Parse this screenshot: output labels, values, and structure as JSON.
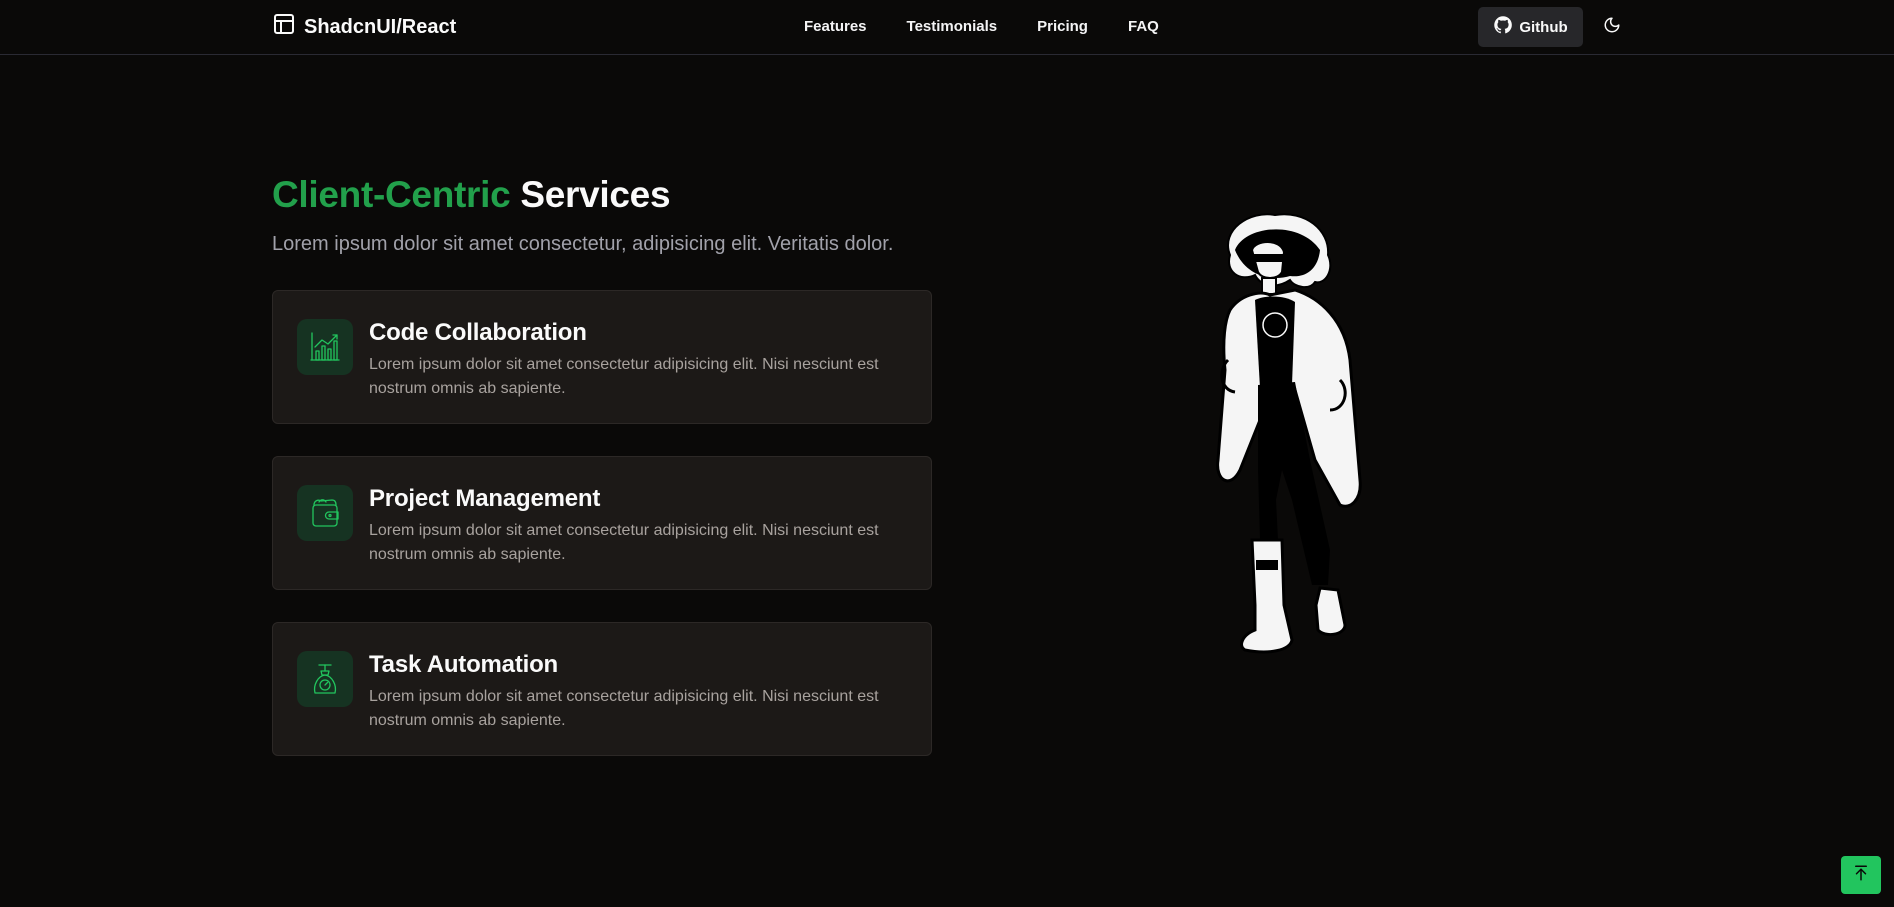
{
  "navbar": {
    "brand": "ShadcnUI/React",
    "links": [
      "Features",
      "Testimonials",
      "Pricing",
      "FAQ"
    ],
    "github_label": "Github"
  },
  "hero": {
    "title_accent": "Client-Centric",
    "title_rest": "Services",
    "subtitle": "Lorem ipsum dolor sit amet consectetur, adipisicing elit. Veritatis dolor."
  },
  "services": [
    {
      "title": "Code Collaboration",
      "description": "Lorem ipsum dolor sit amet consectetur adipisicing elit. Nisi nesciunt est nostrum omnis ab sapiente.",
      "icon": "chart-icon"
    },
    {
      "title": "Project Management",
      "description": "Lorem ipsum dolor sit amet consectetur adipisicing elit. Nisi nesciunt est nostrum omnis ab sapiente.",
      "icon": "wallet-icon"
    },
    {
      "title": "Task Automation",
      "description": "Lorem ipsum dolor sit amet consectetur adipisicing elit. Nisi nesciunt est nostrum omnis ab sapiente.",
      "icon": "scale-icon"
    }
  ],
  "colors": {
    "accent": "#22a04b",
    "button_green": "#22c55e",
    "background": "#0a0908",
    "card": "#1c1917"
  }
}
